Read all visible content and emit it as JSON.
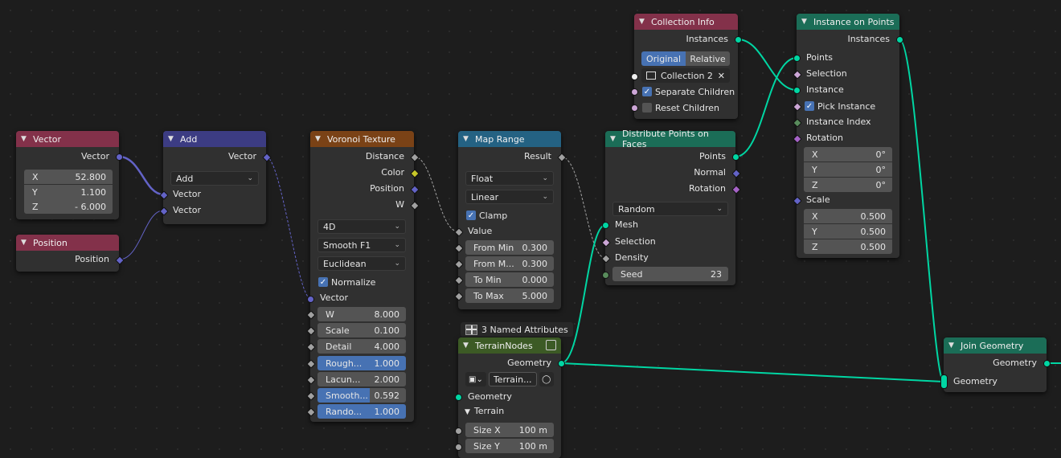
{
  "colors": {
    "geometry": "#00d6a3",
    "vector": "#6363c7",
    "float": "#a1a1a1",
    "color": "#c7c729",
    "integer": "#598c5c",
    "rotation": "#a663c7",
    "boolean": "#cca6d6",
    "selected_field": "#4772b3"
  },
  "vector_node": {
    "title": "Vector",
    "out": "Vector",
    "x_lbl": "X",
    "x": "52.800",
    "y_lbl": "Y",
    "y": "1.100",
    "z_lbl": "Z",
    "z": "- 6.000"
  },
  "position_node": {
    "title": "Position",
    "out": "Position"
  },
  "add_node": {
    "title": "Add",
    "out": "Vector",
    "op": "Add",
    "in1": "Vector",
    "in2": "Vector"
  },
  "voronoi": {
    "title": "Voronoi Texture",
    "out_distance": "Distance",
    "out_color": "Color",
    "out_position": "Position",
    "out_w": "W",
    "dim": "4D",
    "feature": "Smooth F1",
    "metric": "Euclidean",
    "normalize": "Normalize",
    "in_vector": "Vector",
    "w_lbl": "W",
    "w": "8.000",
    "scale_lbl": "Scale",
    "scale": "0.100",
    "detail_lbl": "Detail",
    "detail": "4.000",
    "rough_lbl": "Rough...",
    "rough": "1.000",
    "lacun_lbl": "Lacun...",
    "lacun": "2.000",
    "smooth_lbl": "Smooth...",
    "smooth": "0.592",
    "rando_lbl": "Rando...",
    "rando": "1.000"
  },
  "map_range": {
    "title": "Map Range",
    "out": "Result",
    "type": "Float",
    "interp": "Linear",
    "clamp": "Clamp",
    "in_value": "Value",
    "fmin_lbl": "From Min",
    "fmin": "0.300",
    "fmax_lbl": "From M...",
    "fmax": "0.300",
    "tmin_lbl": "To Min",
    "tmin": "0.000",
    "tmax_lbl": "To Max",
    "tmax": "5.000"
  },
  "terrain": {
    "attrs": "3 Named Attributes",
    "title": "TerrainNodes",
    "out": "Geometry",
    "group": "Terrain...",
    "in_geo": "Geometry",
    "panel": "Terrain",
    "sizex_lbl": "Size X",
    "sizex": "100 m",
    "sizey_lbl": "Size Y",
    "sizey": "100 m"
  },
  "distribute": {
    "title": "Distribute Points on Faces",
    "out_points": "Points",
    "out_normal": "Normal",
    "out_rotation": "Rotation",
    "mode": "Random",
    "in_mesh": "Mesh",
    "in_selection": "Selection",
    "in_density": "Density",
    "seed_lbl": "Seed",
    "seed": "23"
  },
  "collection": {
    "title": "Collection Info",
    "out": "Instances",
    "original": "Original",
    "relative": "Relative",
    "name": "Collection 2",
    "sep": "Separate Children",
    "reset": "Reset Children"
  },
  "instance": {
    "title": "Instance on Points",
    "out": "Instances",
    "in_points": "Points",
    "in_selection": "Selection",
    "in_instance": "Instance",
    "pick": "Pick Instance",
    "in_index": "Instance Index",
    "in_rotation": "Rotation",
    "rx_lbl": "X",
    "rx": "0°",
    "ry_lbl": "Y",
    "ry": "0°",
    "rz_lbl": "Z",
    "rz": "0°",
    "in_scale": "Scale",
    "sx_lbl": "X",
    "sx": "0.500",
    "sy_lbl": "Y",
    "sy": "0.500",
    "sz_lbl": "Z",
    "sz": "0.500"
  },
  "join": {
    "title": "Join Geometry",
    "out": "Geometry",
    "in": "Geometry"
  }
}
